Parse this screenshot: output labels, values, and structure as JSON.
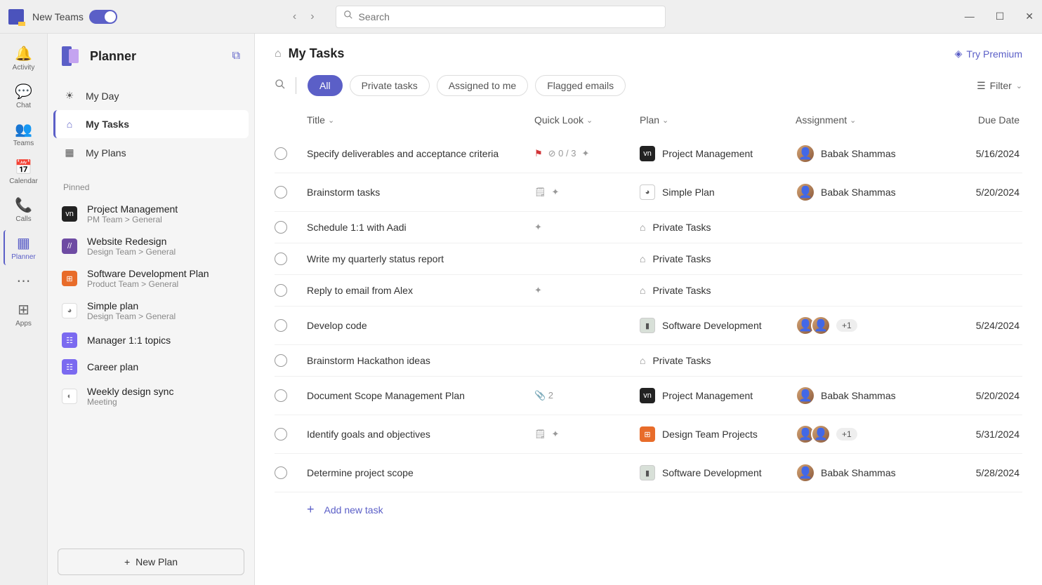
{
  "titlebar": {
    "new_teams": "New Teams",
    "search_placeholder": "Search"
  },
  "rail": {
    "activity": "Activity",
    "chat": "Chat",
    "teams": "Teams",
    "calendar": "Calendar",
    "calls": "Calls",
    "planner": "Planner",
    "apps": "Apps"
  },
  "sidebar": {
    "title": "Planner",
    "nav": {
      "myday": "My Day",
      "mytasks": "My Tasks",
      "myplans": "My Plans"
    },
    "pinned_label": "Pinned",
    "pinned": [
      {
        "name": "Project Management",
        "path": "PM Team > General",
        "color": "#222",
        "icon": "vn"
      },
      {
        "name": "Website Redesign",
        "path": "Design Team > General",
        "color": "#6e4ba3",
        "icon": "//"
      },
      {
        "name": "Software Development Plan",
        "path": "Product Team > General",
        "color": "#e86c2a",
        "icon": "⊞"
      },
      {
        "name": "Simple plan",
        "path": "Design Team > General",
        "color": "#fff",
        "icon": "◕"
      },
      {
        "name": "Manager 1:1 topics",
        "path": "",
        "color": "#7b6af0",
        "icon": "☷"
      },
      {
        "name": "Career plan",
        "path": "",
        "color": "#7b6af0",
        "icon": "☷"
      },
      {
        "name": "Weekly design sync",
        "path": "Meeting",
        "color": "#fff",
        "icon": "◐"
      }
    ],
    "new_plan": "New Plan"
  },
  "main": {
    "title": "My Tasks",
    "premium": "Try Premium",
    "pills": {
      "all": "All",
      "private": "Private tasks",
      "assigned": "Assigned to me",
      "flagged": "Flagged emails"
    },
    "filter": "Filter",
    "columns": {
      "title": "Title",
      "quick": "Quick Look",
      "plan": "Plan",
      "assignment": "Assignment",
      "due": "Due Date"
    },
    "tasks": [
      {
        "title": "Specify deliverables and acceptance criteria",
        "quick_flag": true,
        "quick_progress": "0 / 3",
        "quick_star": true,
        "plan": "Project Management",
        "plan_color": "#222",
        "plan_label": "vn",
        "assignee": "Babak Shammas",
        "avatars": 1,
        "due": "5/16/2024"
      },
      {
        "title": "Brainstorm tasks",
        "quick_note": true,
        "quick_star": true,
        "plan": "Simple Plan",
        "plan_color": "#fff",
        "plan_label": "◕",
        "assignee": "Babak Shammas",
        "avatars": 1,
        "due": "5/20/2024"
      },
      {
        "title": "Schedule 1:1 with Aadi",
        "quick_star": true,
        "plan": "Private Tasks",
        "plan_private": true,
        "assignee": "",
        "due": ""
      },
      {
        "title": "Write my quarterly status report",
        "plan": "Private Tasks",
        "plan_private": true,
        "assignee": "",
        "due": ""
      },
      {
        "title": "Reply to email from Alex",
        "quick_star": true,
        "plan": "Private Tasks",
        "plan_private": true,
        "assignee": "",
        "due": ""
      },
      {
        "title": "Develop code",
        "plan": "Software Development",
        "plan_color": "#d8e0d8",
        "plan_label": "▮",
        "assignee": "",
        "avatars": 2,
        "plus": "+1",
        "due": "5/24/2024"
      },
      {
        "title": "Brainstorm Hackathon ideas",
        "plan": "Private Tasks",
        "plan_private": true,
        "assignee": "",
        "due": ""
      },
      {
        "title": "Document Scope Management Plan",
        "quick_attach": "2",
        "plan": "Project Management",
        "plan_color": "#222",
        "plan_label": "vn",
        "assignee": "Babak Shammas",
        "avatars": 1,
        "due": "5/20/2024"
      },
      {
        "title": "Identify goals and objectives",
        "quick_note": true,
        "quick_star": true,
        "plan": "Design Team Projects",
        "plan_color": "#e86c2a",
        "plan_label": "⊞",
        "assignee": "",
        "avatars": 2,
        "plus": "+1",
        "due": "5/31/2024"
      },
      {
        "title": "Determine project scope",
        "plan": "Software Development",
        "plan_color": "#d8e0d8",
        "plan_label": "▮",
        "assignee": "Babak Shammas",
        "avatars": 1,
        "due": "5/28/2024"
      }
    ],
    "add_task": "Add new task"
  }
}
